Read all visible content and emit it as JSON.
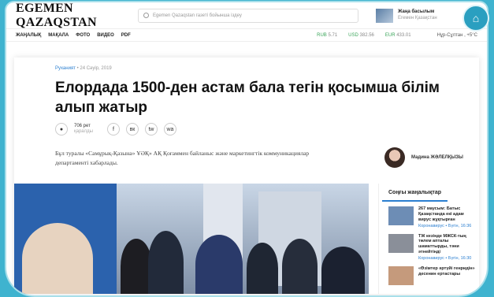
{
  "header": {
    "logo": "EGEMEN QAZAQSTAN",
    "search_placeholder": "Egemen Qazaqstan газеті бойынша іздеу",
    "promo_title": "Жаңа басылым",
    "promo_sub": "Егемен Қазақстан"
  },
  "nav": {
    "items": [
      "ЖАҢАЛЫҚ",
      "МАҚАЛА",
      "ФОТО",
      "ВИДЕО",
      "PDF"
    ],
    "rates": [
      {
        "label": "RUB",
        "value": "5.71"
      },
      {
        "label": "USD",
        "value": "382.56"
      },
      {
        "label": "EUR",
        "value": "433.01"
      }
    ],
    "city": "Нұр-Сұлтан , +5°С"
  },
  "article": {
    "category": "Руханият",
    "date": "24 Сәуір, 2019",
    "title": "Елордада 1500-ден астам бала тегін қосымша білім алып жатыр",
    "views": "706 рет",
    "views_label": "қаралды",
    "share_icons": [
      "f",
      "вк",
      "tw",
      "wa"
    ],
    "lead": "Бұл туралы «Самұрық-Қазына» ҰӘҚ» АҚ Қоғаммен байланыс және маркетингтік коммуникациялар департаменті хабарлады.",
    "author": "Мадина ЖӘЛЕЛҚЫЗЫ"
  },
  "sidebar": {
    "title": "Соңғы жаңалықтар",
    "news": [
      {
        "title": "267 маусым: Батыс Қазақстанда екі адам вирус жұқтырған",
        "time": "Коронавирус • Бүгін, 16:36"
      },
      {
        "title": "ТЖ кезінде МЖСК-тың төлем апталы шаматтырды, тәни әтнейтінді",
        "time": "Коронавирус • Бүгін, 16:30"
      },
      {
        "title": "«Өзімтер әртүйі генридін» десенин ертастары",
        "time": ""
      }
    ]
  },
  "colors": {
    "background": "#3fb3cf",
    "accent": "#2b7fd0"
  }
}
